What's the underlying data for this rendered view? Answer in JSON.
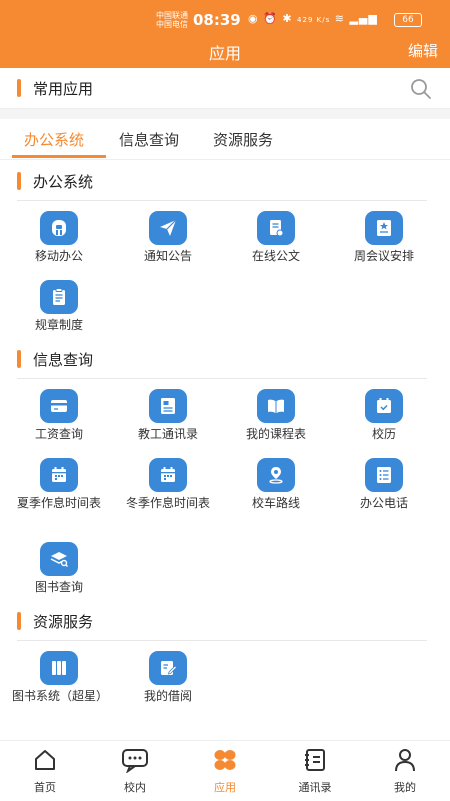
{
  "status": {
    "carrier1": "中国联通",
    "carrier2": "中国电信",
    "time": "08:39",
    "speed": "429 K/s",
    "battery": "66"
  },
  "header": {
    "title": "应用",
    "edit": "编辑"
  },
  "favorites": {
    "title": "常用应用"
  },
  "tabs": [
    {
      "label": "办公系统",
      "active": true
    },
    {
      "label": "信息查询",
      "active": false
    },
    {
      "label": "资源服务",
      "active": false
    }
  ],
  "sections": [
    {
      "title": "办公系统",
      "apps": [
        {
          "label": "移动办公",
          "icon": "mobile-office-icon"
        },
        {
          "label": "通知公告",
          "icon": "paper-plane-icon"
        },
        {
          "label": "在线公文",
          "icon": "document-icon"
        },
        {
          "label": "周会议安排",
          "icon": "meeting-icon"
        },
        {
          "label": "规章制度",
          "icon": "clipboard-icon"
        }
      ]
    },
    {
      "title": "信息查询",
      "apps": [
        {
          "label": "工资查询",
          "icon": "card-icon"
        },
        {
          "label": "教工通讯录",
          "icon": "contacts-icon"
        },
        {
          "label": "我的课程表",
          "icon": "book-icon"
        },
        {
          "label": "校历",
          "icon": "calendar-icon"
        },
        {
          "label": "夏季作息时间表",
          "icon": "calendar-icon"
        },
        {
          "label": "冬季作息时间表",
          "icon": "calendar-icon"
        },
        {
          "label": "校车路线",
          "icon": "location-icon"
        },
        {
          "label": "办公电话",
          "icon": "list-icon"
        },
        {
          "label": "图书查询",
          "icon": "books-search-icon"
        }
      ]
    },
    {
      "title": "资源服务",
      "apps": [
        {
          "label": "图书系统（超星）",
          "icon": "library-icon"
        },
        {
          "label": "我的借阅",
          "icon": "edit-icon"
        }
      ]
    }
  ],
  "nav": [
    {
      "label": "首页",
      "icon": "home-icon",
      "active": false
    },
    {
      "label": "校内",
      "icon": "chat-icon",
      "active": false
    },
    {
      "label": "应用",
      "icon": "apps-icon",
      "active": true
    },
    {
      "label": "通讯录",
      "icon": "address-book-icon",
      "active": false
    },
    {
      "label": "我的",
      "icon": "user-icon",
      "active": false
    }
  ],
  "colors": {
    "accent": "#f58a33",
    "icon_blue": "#3a89d8"
  }
}
